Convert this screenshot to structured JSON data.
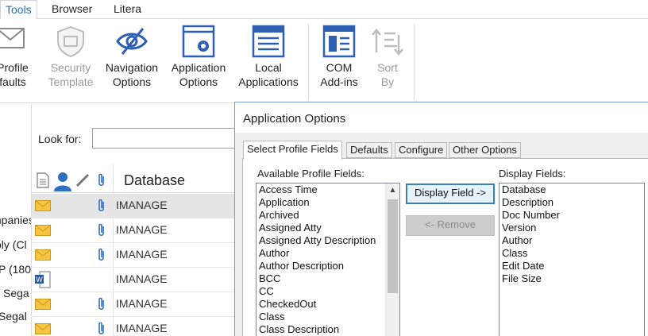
{
  "tabs": [
    {
      "label": "Tools",
      "active": true
    },
    {
      "label": "Browser",
      "active": false
    },
    {
      "label": "Litera",
      "active": false
    }
  ],
  "ribbon": {
    "buttons": [
      {
        "label1": "Profile",
        "label2": "faults",
        "icon": "envelope-check-icon",
        "disabled": false
      },
      {
        "label1": "Security",
        "label2": "Template",
        "icon": "shield-icon",
        "disabled": true
      },
      {
        "label1": "Navigation",
        "label2": "Options",
        "icon": "eye-slash-icon",
        "disabled": false
      },
      {
        "label1": "Application",
        "label2": "Options",
        "icon": "window-gear-icon",
        "disabled": false
      },
      {
        "label1": "Local",
        "label2": "Applications",
        "icon": "window-list-icon",
        "disabled": false
      },
      {
        "label1": "COM",
        "label2": "Add-ins",
        "icon": "com-addin-icon",
        "disabled": false
      },
      {
        "label1": "Sort",
        "label2": "By",
        "icon": "sort-icon",
        "disabled": true
      }
    ]
  },
  "left_panel": {
    "items": [
      "mpanies",
      "oly (Cl",
      "P (180",
      "Sega",
      "Segal"
    ]
  },
  "search": {
    "label": "Look for:",
    "value": ""
  },
  "grid": {
    "header": "Database",
    "rows": [
      {
        "database": "IMANAGE",
        "type": "email",
        "attachment": true,
        "selected": true
      },
      {
        "database": "IMANAGE",
        "type": "email",
        "attachment": true,
        "selected": false
      },
      {
        "database": "IMANAGE",
        "type": "email",
        "attachment": true,
        "selected": false
      },
      {
        "database": "IMANAGE",
        "type": "word",
        "attachment": false,
        "selected": false
      },
      {
        "database": "IMANAGE",
        "type": "email",
        "attachment": true,
        "selected": false
      },
      {
        "database": "IMANAGE",
        "type": "email",
        "attachment": true,
        "selected": false
      }
    ]
  },
  "dialog": {
    "title": "Application Options",
    "tabs": [
      "Select Profile Fields",
      "Defaults",
      "Configure",
      "Other Options"
    ],
    "available_label": "Available Profile Fields:",
    "display_label": "Display Fields:",
    "available_fields": [
      "Access Time",
      "Application",
      "Archived",
      "Assigned Atty",
      "Assigned Atty Description",
      "Author",
      "Author Description",
      "BCC",
      "CC",
      "CheckedOut",
      "Class",
      "Class Description"
    ],
    "display_fields": [
      "Database",
      "Description",
      "Doc Number",
      "Version",
      "Author",
      "Class",
      "Edit Date",
      "File Size"
    ],
    "display_button": "Display Field ->",
    "remove_button": "<- Remove"
  },
  "colors": {
    "accent": "#2b6fb6",
    "icon_blue": "#2f5fb3",
    "envelope": "#f5c542"
  }
}
